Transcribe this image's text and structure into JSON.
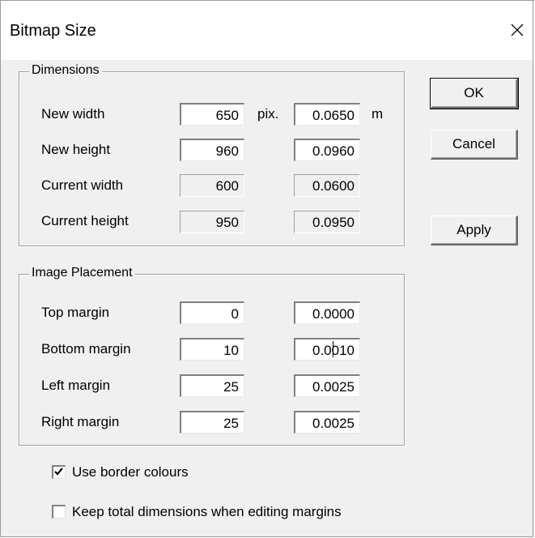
{
  "window": {
    "title": "Bitmap Size"
  },
  "dimensions": {
    "legend": "Dimensions",
    "rows": [
      {
        "label": "New width",
        "pix": "650",
        "m": "0.0650",
        "pix_unit": "pix.",
        "m_unit": "m",
        "readonly": false
      },
      {
        "label": "New height",
        "pix": "960",
        "m": "0.0960",
        "readonly": false
      },
      {
        "label": "Current width",
        "pix": "600",
        "m": "0.0600",
        "readonly": true
      },
      {
        "label": "Current height",
        "pix": "950",
        "m": "0.0950",
        "readonly": true
      }
    ]
  },
  "placement": {
    "legend": "Image Placement",
    "rows": [
      {
        "label": "Top margin",
        "pix": "0",
        "m": "0.0000"
      },
      {
        "label": "Bottom margin",
        "pix": "10",
        "m": "0.0010"
      },
      {
        "label": "Left margin",
        "pix": "25",
        "m": "0.0025"
      },
      {
        "label": "Right margin",
        "pix": "25",
        "m": "0.0025"
      }
    ]
  },
  "buttons": {
    "ok": "OK",
    "cancel": "Cancel",
    "apply": "Apply"
  },
  "options": {
    "use_border_colours": {
      "label": "Use border colours",
      "checked": true
    },
    "keep_total_dimensions": {
      "label": "Keep total dimensions when editing margins",
      "checked": false
    }
  }
}
